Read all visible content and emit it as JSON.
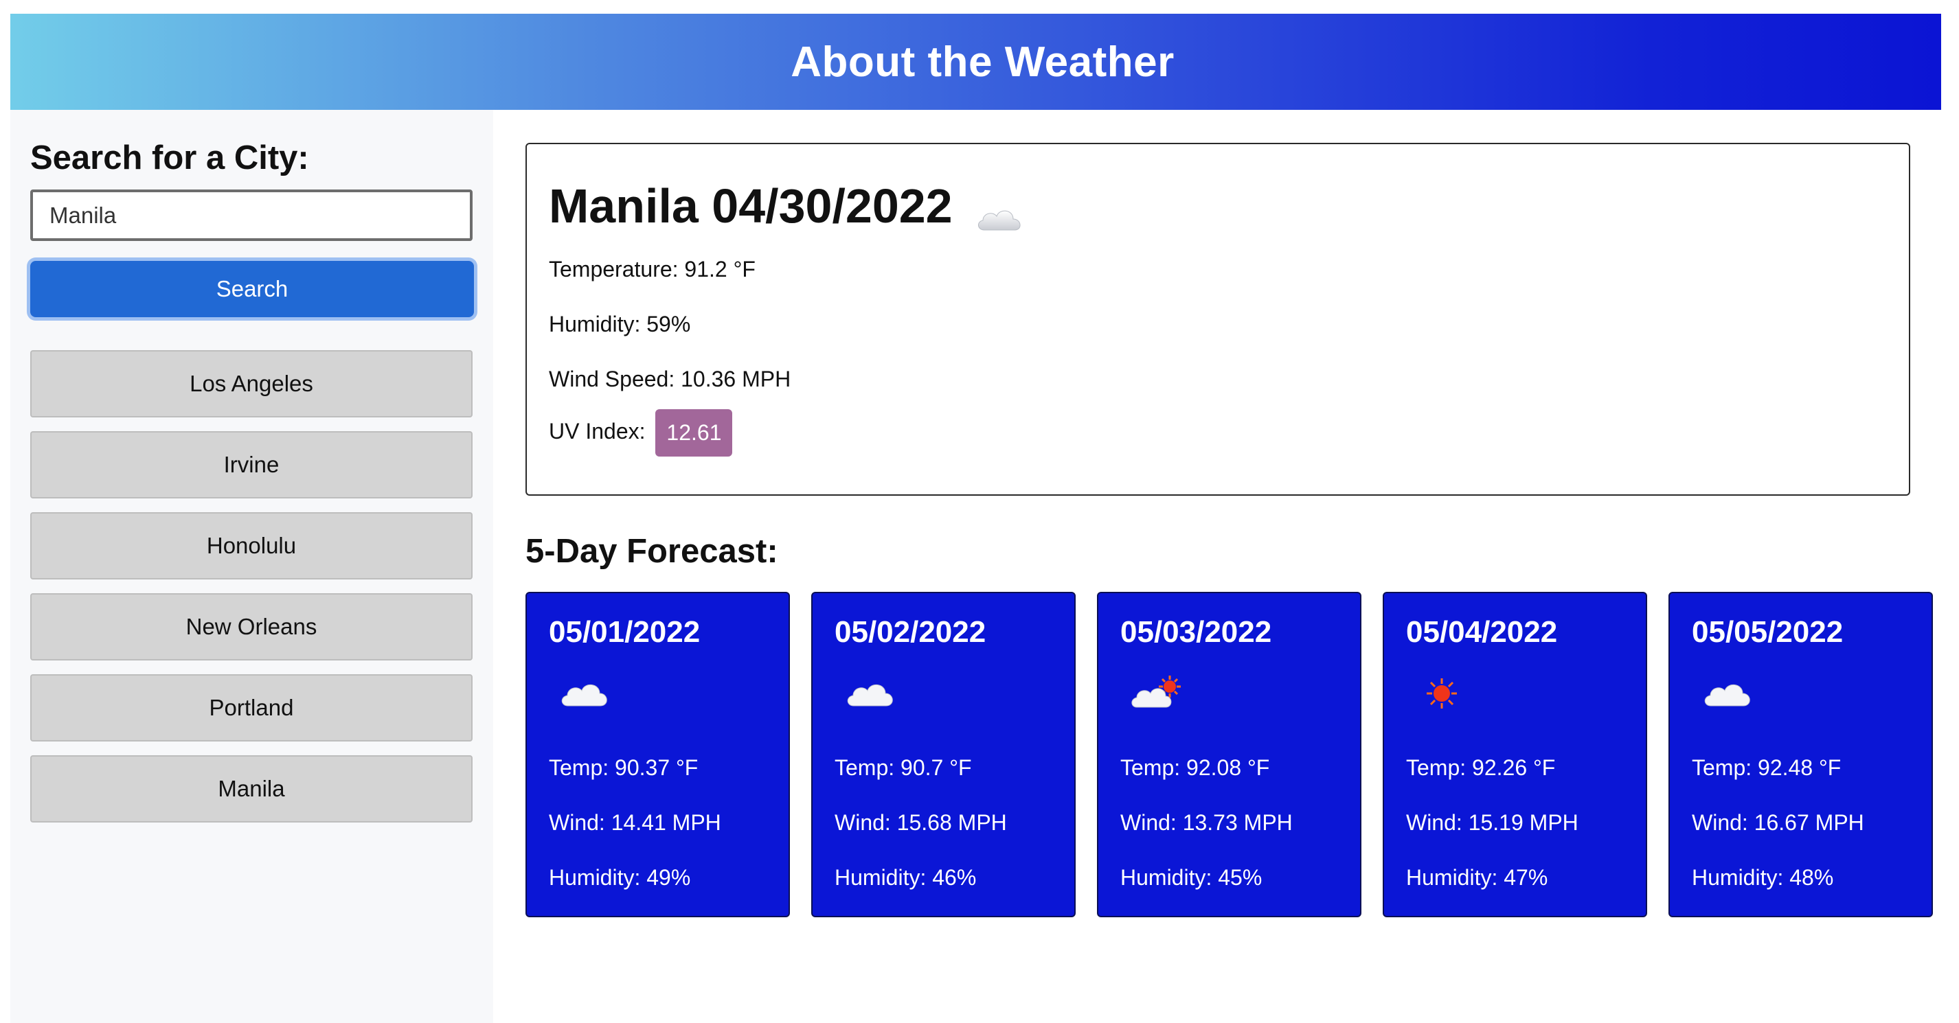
{
  "header": {
    "title": "About the Weather"
  },
  "sidebar": {
    "search_title": "Search for a City:",
    "search_value": "Manila",
    "search_button": "Search",
    "history": [
      "Los Angeles",
      "Irvine",
      "Honolulu",
      "New Orleans",
      "Portland",
      "Manila"
    ]
  },
  "current": {
    "title": "Manila 04/30/2022",
    "icon": "cloud-icon",
    "temperature": "Temperature: 91.2 °F",
    "humidity": "Humidity: 59%",
    "wind": "Wind Speed: 10.36 MPH",
    "uv_label": "UV Index:",
    "uv_value": "12.61",
    "uv_color": "#a2679a"
  },
  "forecast": {
    "title": "5-Day Forecast:",
    "card_color": "#0b16d6",
    "days": [
      {
        "date": "05/01/2022",
        "icon": "cloud-icon",
        "temp": "Temp: 90.37 °F",
        "wind": "Wind: 14.41 MPH",
        "humidity": "Humidity: 49%"
      },
      {
        "date": "05/02/2022",
        "icon": "cloud-icon",
        "temp": "Temp: 90.7 °F",
        "wind": "Wind: 15.68 MPH",
        "humidity": "Humidity: 46%"
      },
      {
        "date": "05/03/2022",
        "icon": "cloud-sun-icon",
        "temp": "Temp: 92.08 °F",
        "wind": "Wind: 13.73 MPH",
        "humidity": "Humidity: 45%"
      },
      {
        "date": "05/04/2022",
        "icon": "sun-icon",
        "temp": "Temp: 92.26 °F",
        "wind": "Wind: 15.19 MPH",
        "humidity": "Humidity: 47%"
      },
      {
        "date": "05/05/2022",
        "icon": "cloud-icon",
        "temp": "Temp: 92.48 °F",
        "wind": "Wind: 16.67 MPH",
        "humidity": "Humidity: 48%"
      }
    ]
  }
}
